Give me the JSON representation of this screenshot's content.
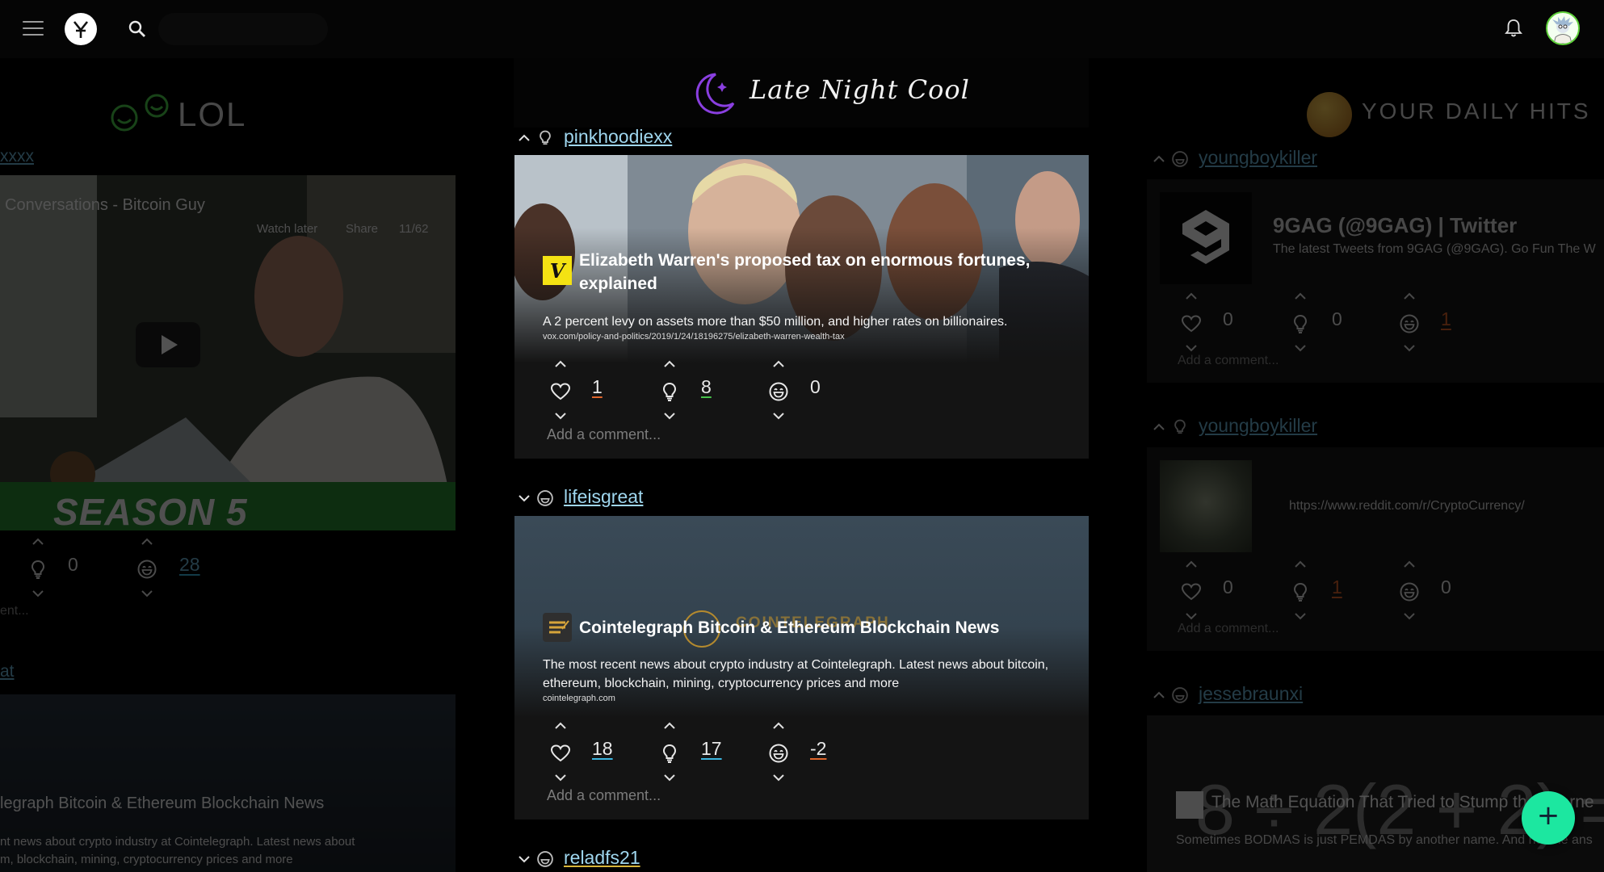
{
  "header": {
    "menu_icon": "hamburger-menu-icon",
    "logo_icon": "app-logo-icon",
    "search_icon": "search-icon",
    "bell_icon": "notification-bell-icon",
    "avatar_icon": "user-avatar"
  },
  "left_column": {
    "title": "LOL",
    "users": [
      "xxxx",
      "at"
    ],
    "video_title": "Conversations - Bitcoin Guy",
    "video_controls": [
      "Watch later",
      "Share",
      "11/62"
    ],
    "video_caption": "SEASON 5",
    "votes": [
      {
        "icon": "lightbulb-icon",
        "count": "0"
      },
      {
        "icon": "smile-icon",
        "count": "28"
      }
    ],
    "comment_stub": "ent...",
    "card2_title": "legraph Bitcoin & Ethereum Blockchain News",
    "card2_desc_1": "nt news about crypto industry at Cointelegraph. Latest news about",
    "card2_desc_2": "m, blockchain, mining, cryptocurrency prices and more"
  },
  "feed": {
    "title": "Late Night Cool",
    "posts": [
      {
        "user": "pinkhoodiexx",
        "title_line1": "Elizabeth Warren's proposed tax on enormous fortunes,",
        "title_line2": "explained",
        "description": "A 2 percent levy on assets more than $50 million, and higher rates on billionaires.",
        "link": "vox.com/policy-and-politics/2019/1/24/18196275/elizabeth-warren-wealth-tax",
        "site_badge": "V",
        "votes": {
          "heart": "1",
          "lightbulb": "8",
          "smile": "0"
        },
        "comment_placeholder": "Add a comment..."
      },
      {
        "user": "lifeisgreat",
        "title_line1": "Cointelegraph Bitcoin & Ethereum Blockchain News",
        "overlay_logo": "COINTELEGRAPH",
        "description": "The most recent news about crypto industry at Cointelegraph. Latest news about bitcoin, ethereum, blockchain, mining, cryptocurrency prices and more",
        "link": "cointelegraph.com",
        "votes": {
          "heart": "18",
          "lightbulb": "17",
          "smile": "-2"
        },
        "comment_placeholder": "Add a comment..."
      },
      {
        "user": "reladfs21"
      }
    ]
  },
  "right_column": {
    "title": "YOUR DAILY HITS",
    "posts": [
      {
        "user": "youngboykiller",
        "title": "9GAG (@9GAG) | Twitter",
        "description": "The latest Tweets from 9GAG (@9GAG). Go Fun The W",
        "votes": {
          "heart": "0",
          "lightbulb": "0",
          "smile": "1"
        },
        "comment_placeholder": "Add a comment..."
      },
      {
        "user": "youngboykiller",
        "link": "https://www.reddit.com/r/CryptoCurrency/",
        "votes": {
          "heart": "0",
          "lightbulb": "1",
          "smile": "0"
        },
        "comment_placeholder": "Add a comment..."
      },
      {
        "user": "jessebraunxi",
        "title": "The Math Equation That Tried to Stump the Interne",
        "description": "Sometimes BODMAS is just PEMDAS by another name. And no, the ans",
        "bg_equation": "8 ÷ 2(2 + 2) ="
      }
    ]
  },
  "fab_label": "+",
  "colors": {
    "accent_fab": "#1ce7a0",
    "link": "#9fd6ee",
    "orange": "#e0652b",
    "green": "#46c24a",
    "blue": "#3cb6e0"
  }
}
